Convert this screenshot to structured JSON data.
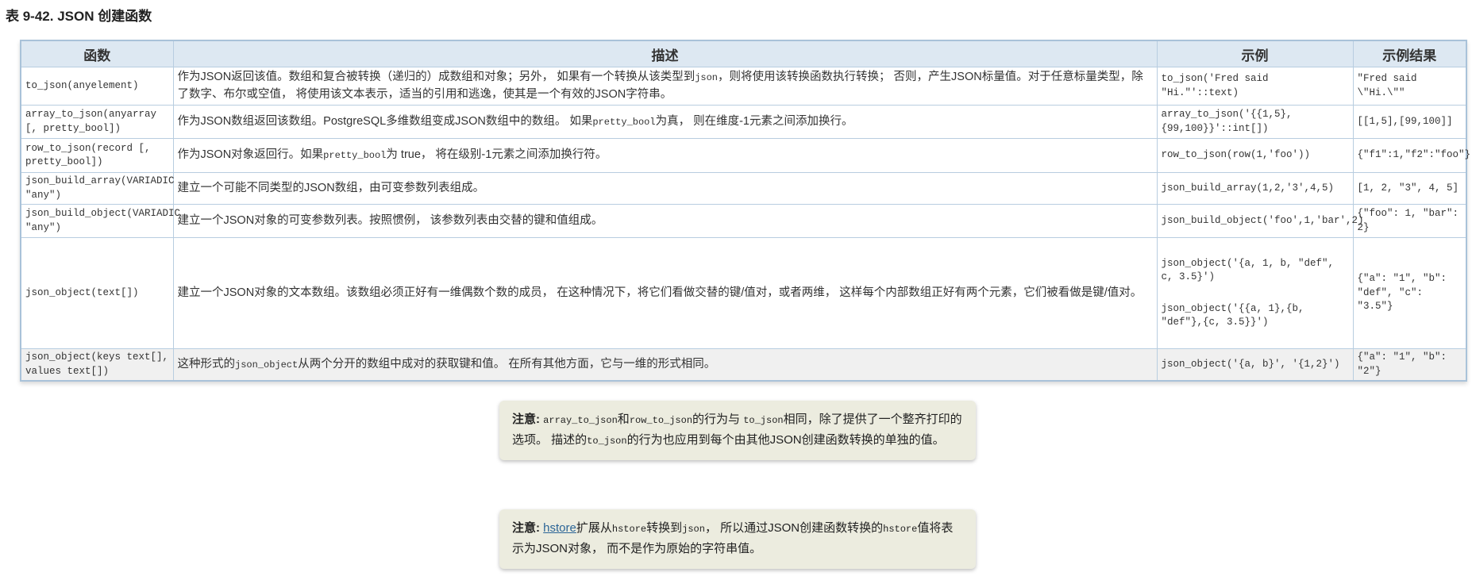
{
  "title": "表 9-42. JSON 创建函数",
  "headers": [
    "函数",
    "描述",
    "示例",
    "示例结果"
  ],
  "rows": [
    {
      "func": "to_json(anyelement)",
      "desc": [
        "作为JSON返回该值。数组和复合被转换（递归的）成数组和对象；另外， 如果有一个转换从该类型到",
        "json",
        "，则将使用该转换函数执行转换； 否则，产生JSON标量值。对于任意标量类型，除了数字、布尔或空值， 将使用该文本表示，适当的引用和逃逸，使其是一个有效的JSON字符串。"
      ],
      "example": [
        "to_json('Fred said \"Hi.\"'::text)"
      ],
      "result": "\"Fred said \\\"Hi.\\\"\""
    },
    {
      "func": "array_to_json(anyarray [, pretty_bool])",
      "desc": [
        "作为JSON数组返回该数组。PostgreSQL多维数组变成JSON数组中的数组。 如果",
        "pretty_bool",
        "为真， 则在维度-1元素之间添加换行。"
      ],
      "example": [
        "array_to_json('{{1,5},{99,100}}'::int[])"
      ],
      "result": "[[1,5],[99,100]]"
    },
    {
      "func": "row_to_json(record [, pretty_bool])",
      "desc": [
        "作为JSON对象返回行。如果",
        "pretty_bool",
        "为 true， 将在级别-1元素之间添加换行符。"
      ],
      "example": [
        "row_to_json(row(1,'foo'))"
      ],
      "result": "{\"f1\":1,\"f2\":\"foo\"}"
    },
    {
      "func": "json_build_array(VARIADIC \"any\")",
      "desc": [
        "建立一个可能不同类型的JSON数组，由可变参数列表组成。",
        "",
        ""
      ],
      "example": [
        "json_build_array(1,2,'3',4,5)"
      ],
      "result": "[1, 2, \"3\", 4, 5]"
    },
    {
      "func": "json_build_object(VARIADIC \"any\")",
      "desc": [
        "建立一个JSON对象的可变参数列表。按照惯例， 该参数列表由交替的键和值组成。",
        "",
        ""
      ],
      "example": [
        "json_build_object('foo',1,'bar',2)"
      ],
      "result": "{\"foo\": 1, \"bar\": 2}"
    },
    {
      "func": "json_object(text[])",
      "desc": [
        "建立一个JSON对象的文本数组。该数组必须正好有一维偶数个数的成员， 在这种情况下，将它们看做交替的键/值对，或者两维， 这样每个内部数组正好有两个元素，它们被看做是键/值对。",
        "",
        ""
      ],
      "example": [
        "json_object('{a, 1, b, \"def\", c, 3.5}')",
        "json_object('{{a, 1},{b, \"def\"},{c, 3.5}}')"
      ],
      "result": "{\"a\": \"1\", \"b\": \"def\", \"c\": \"3.5\"}"
    },
    {
      "func": "json_object(keys text[], values text[])",
      "desc": [
        "这种形式的",
        "json_object",
        "从两个分开的数组中成对的获取键和值。 在所有其他方面，它与一维的形式相同。"
      ],
      "example": [
        "json_object('{a, b}', '{1,2}')"
      ],
      "result": "{\"a\": \"1\", \"b\": \"2\"}"
    }
  ],
  "notes": [
    {
      "label": "注意:",
      "parts": [
        "array_to_json",
        "和",
        "row_to_json",
        "的行为与 ",
        "to_json",
        "相同，除了提供了一个整齐打印的选项。 描述的",
        "to_json",
        "的行为也应用到每个由其他JSON创建函数转换的单独的值。"
      ]
    },
    {
      "label": "注意:",
      "link": "hstore",
      "parts": [
        "扩展从",
        "hstore",
        "转换到",
        "json",
        "， 所以通过JSON创建函数转换的",
        "hstore",
        "值将表示为JSON对象， 而不是作为原始的字符串值。"
      ]
    }
  ]
}
